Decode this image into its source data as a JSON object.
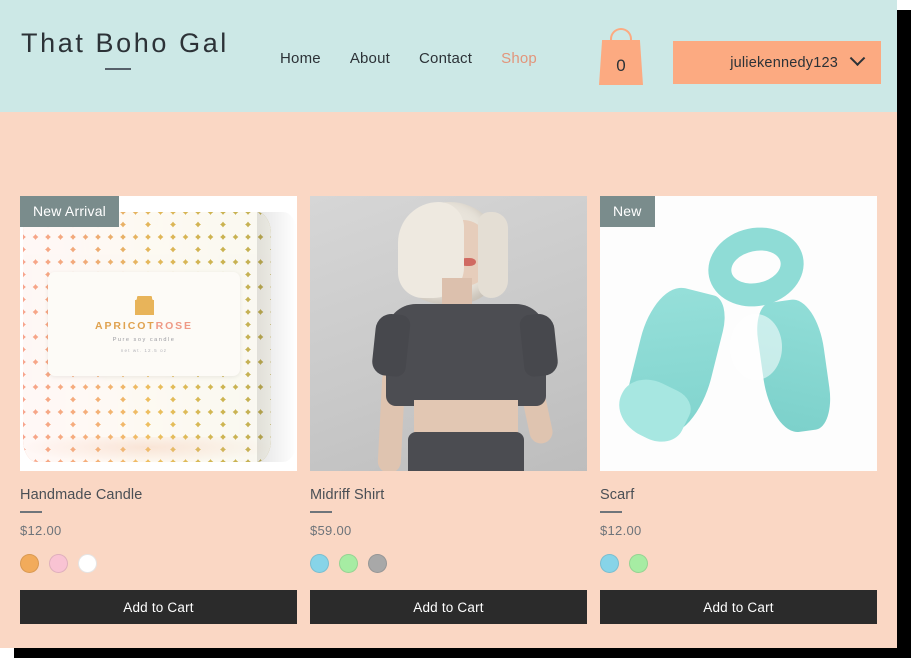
{
  "site": {
    "brand_title": "That Boho Gal"
  },
  "nav": {
    "items": [
      {
        "label": "Home",
        "active": false
      },
      {
        "label": "About",
        "active": false
      },
      {
        "label": "Contact",
        "active": false
      },
      {
        "label": "Shop",
        "active": true
      }
    ]
  },
  "cart": {
    "count": "0",
    "icon": "shopping-bag-icon"
  },
  "account": {
    "username": "juliekennedy123",
    "chevron_icon": "chevron-down-icon"
  },
  "colors": {
    "header_background": "#cce8e6",
    "page_background": "#fad7c4",
    "accent": "#fcaa81",
    "active_link": "#e2957b",
    "badge_background": "#7a8c8c",
    "button_background": "#2b2b2b",
    "text_dark": "#2c3237"
  },
  "products": [
    {
      "badge": "New Arrival",
      "title": "Handmade Candle",
      "price": "$12.00",
      "add_to_cart_label": "Add to Cart",
      "image_alt": "handmade-candle-image",
      "candle_label": {
        "brand_first": "APRICOT",
        "brand_second": "ROSE",
        "subtitle": "Pure soy candle",
        "net_weight": "net wt. 12.5 oz"
      },
      "swatches": [
        {
          "name": "orange",
          "hex": "#f2ab5b"
        },
        {
          "name": "pink",
          "hex": "#f9c3d3"
        },
        {
          "name": "white",
          "hex": "#ffffff"
        }
      ]
    },
    {
      "badge": "",
      "title": "Midriff Shirt",
      "price": "$59.00",
      "add_to_cart_label": "Add to Cart",
      "image_alt": "midriff-shirt-model-image",
      "swatches": [
        {
          "name": "blue",
          "hex": "#87d4e8"
        },
        {
          "name": "green",
          "hex": "#a6eca3"
        },
        {
          "name": "gray",
          "hex": "#a8a8a8"
        }
      ]
    },
    {
      "badge": "New",
      "title": "Scarf",
      "price": "$12.00",
      "add_to_cart_label": "Add to Cart",
      "image_alt": "turquoise-scarf-image",
      "swatches": [
        {
          "name": "blue",
          "hex": "#87d4e8"
        },
        {
          "name": "green",
          "hex": "#a6eca3"
        }
      ]
    }
  ]
}
